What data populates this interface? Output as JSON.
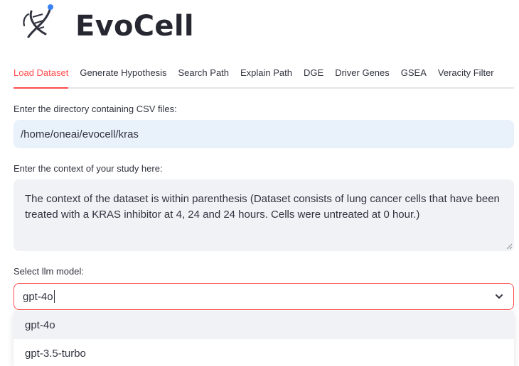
{
  "app": {
    "title": "EvoCell"
  },
  "tabs": [
    {
      "label": "Load Dataset",
      "active": true
    },
    {
      "label": "Generate Hypothesis",
      "active": false
    },
    {
      "label": "Search Path",
      "active": false
    },
    {
      "label": "Explain Path",
      "active": false
    },
    {
      "label": "DGE",
      "active": false
    },
    {
      "label": "Driver Genes",
      "active": false
    },
    {
      "label": "GSEA",
      "active": false
    },
    {
      "label": "Veracity Filter",
      "active": false
    }
  ],
  "form": {
    "directory_label": "Enter the directory containing CSV files:",
    "directory_value": "/home/oneai/evocell/kras",
    "context_label": "Enter the context of your study here:",
    "context_value": "The context of the dataset is within parenthesis (Dataset consists of lung cancer cells that have been treated with a KRAS inhibitor at 4, 24 and 24 hours. Cells were untreated at 0 hour.)",
    "model_label": "Select llm model:",
    "model_value": "gpt-4o",
    "model_options": [
      "gpt-4o",
      "gpt-3.5-turbo"
    ]
  },
  "colors": {
    "accent": "#ff4b4b",
    "text": "#31333f",
    "input_bg": "#f0f2f6",
    "autofill_bg": "#e9f1fb"
  },
  "icons": {
    "logo": "dna-helix-icon",
    "select": "chevron-down-icon"
  }
}
